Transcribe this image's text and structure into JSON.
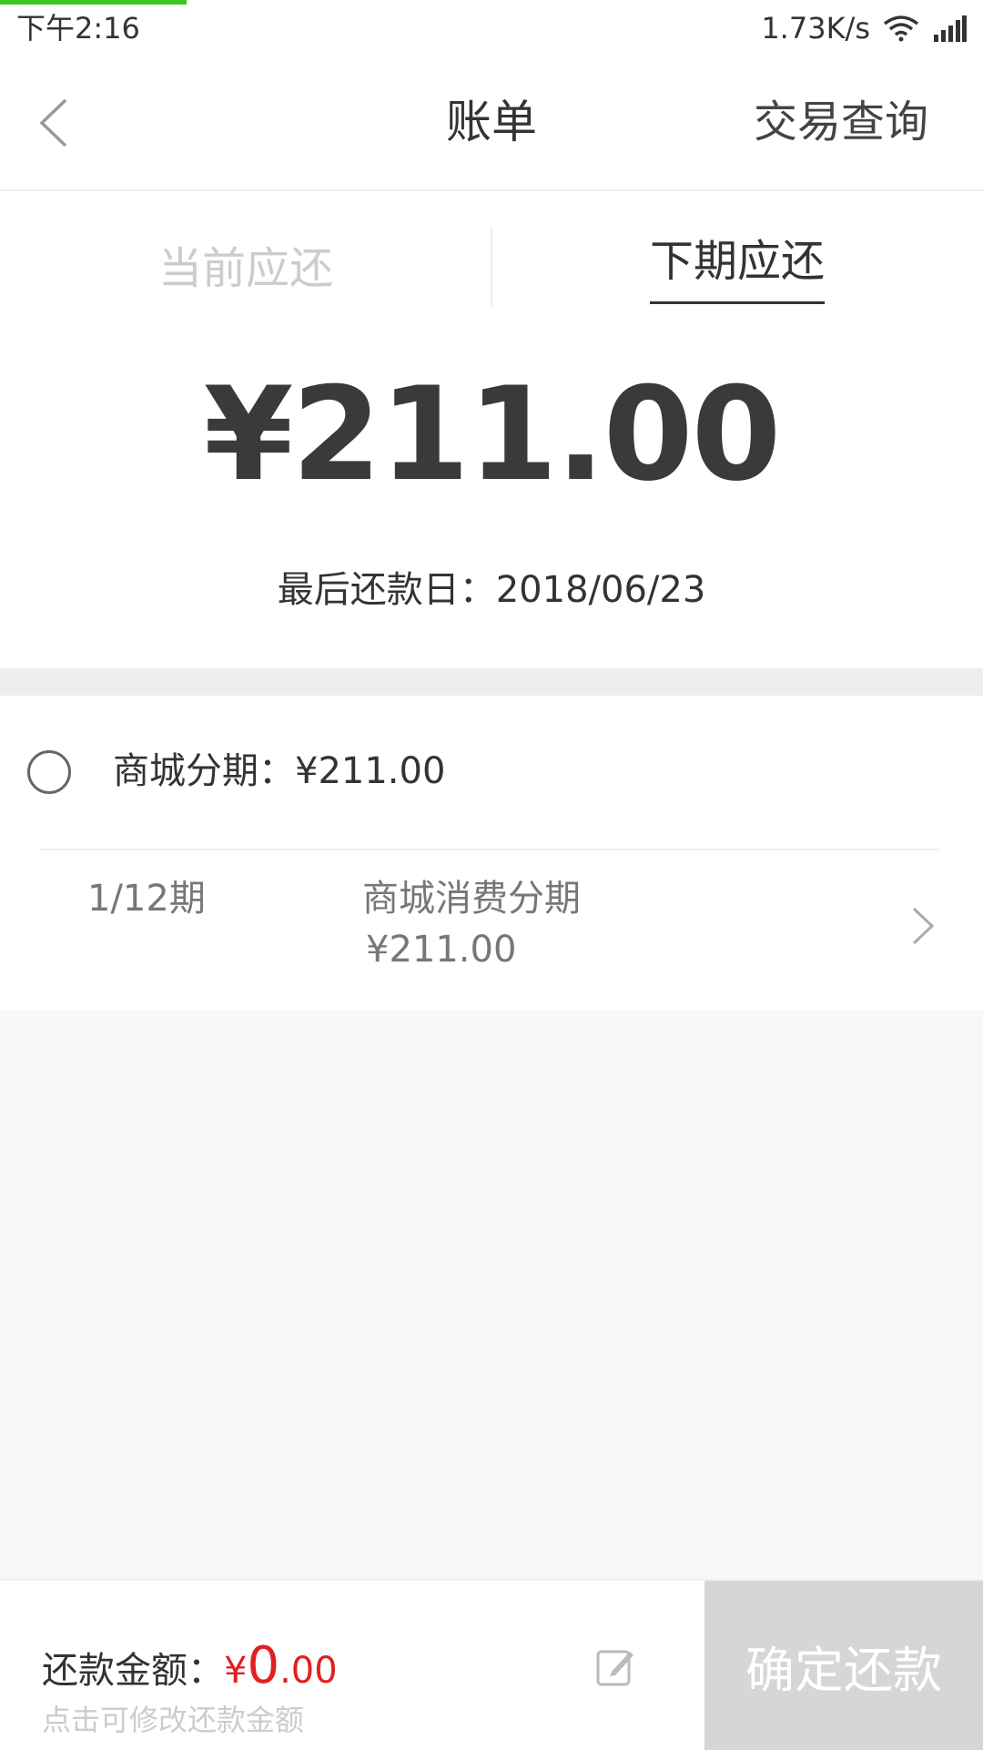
{
  "status_bar": {
    "time": "下午2:16",
    "network_speed": "1.73K/s",
    "wifi_icon": "wifi-icon",
    "signal_icon": "signal-icon",
    "accent_color": "#3cc51f"
  },
  "header": {
    "back_icon": "back-arrow-icon",
    "title": "账单",
    "right_action": "交易查询"
  },
  "tabs": [
    {
      "label": "当前应还",
      "active": false
    },
    {
      "label": "下期应还",
      "active": true
    }
  ],
  "summary": {
    "amount": "¥211.00",
    "due_date_text": "最后还款日：2018/06/23"
  },
  "bill_group": {
    "title": "商城分期：¥211.00",
    "selected": false,
    "items": [
      {
        "period": "1/12期",
        "name": "商城消费分期",
        "amount": "¥211.00"
      }
    ]
  },
  "bottom_bar": {
    "label": "还款金额：",
    "currency": "¥",
    "amount_int": "0",
    "amount_dec": ".00",
    "hint": "点击可修改还款金额",
    "edit_icon": "edit-icon",
    "confirm_label": "确定还款",
    "amount_color": "#e02020"
  }
}
